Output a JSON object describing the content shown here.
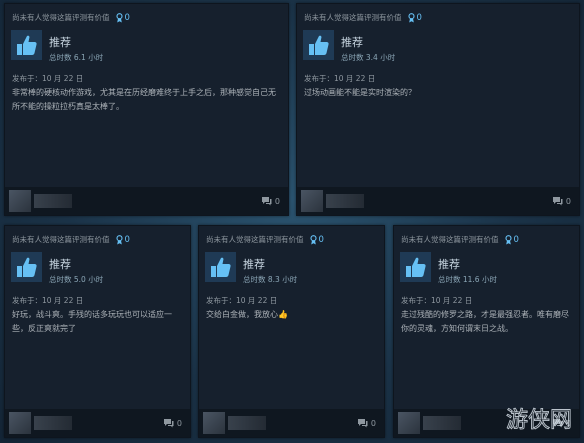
{
  "colors": {
    "accent": "#66c0f4",
    "card_bg": "#16202d",
    "page_bg": "#1b3348"
  },
  "reviews": [
    {
      "helpful_label": "尚未有人觉得这篇评测有价值",
      "award_count": "0",
      "recommend": "推荐",
      "hours": "总时数 6.1 小时",
      "posted": "发布于：10 月 22 日",
      "body": "非常棒的硬核动作游戏，尤其是在历经磨难终于上手之后，那种感觉自己无所不能的操粒拉朽真是太棒了。",
      "comment_count": "0",
      "icon": "thumbs-up-icon"
    },
    {
      "helpful_label": "尚未有人觉得这篇评测有价值",
      "award_count": "0",
      "recommend": "推荐",
      "hours": "总时数 3.4 小时",
      "posted": "发布于：10 月 22 日",
      "body": "过场动画能不能是实时渲染的？",
      "comment_count": "0",
      "icon": "thumbs-up-icon"
    },
    {
      "helpful_label": "尚未有人觉得这篇评测有价值",
      "award_count": "0",
      "recommend": "推荐",
      "hours": "总时数 5.0 小时",
      "posted": "发布于：10 月 22 日",
      "body": "好玩，战斗爽。手残的话多玩玩也可以适应一些，反正爽就完了",
      "comment_count": "0",
      "icon": "thumbs-up-icon"
    },
    {
      "helpful_label": "尚未有人觉得这篇评测有价值",
      "award_count": "0",
      "recommend": "推荐",
      "hours": "总时数 8.3 小时",
      "posted": "发布于：10 月 22 日",
      "body": "交给白金做，我放心",
      "body_emoji": "👍",
      "comment_count": "0",
      "icon": "thumbs-up-icon"
    },
    {
      "helpful_label": "尚未有人觉得这篇评测有价值",
      "award_count": "0",
      "recommend": "推荐",
      "hours": "总时数 11.6 小时",
      "posted": "发布于：10 月 22 日",
      "body": "走过残酷的修罗之路，才是最强忍者。唯有磨尽你的灵魂，方知何谓末日之战。",
      "comment_count": "0",
      "icon": "thumbs-up-icon"
    }
  ],
  "watermark": {
    "text": "游侠网",
    "icon": "youxia-logo"
  }
}
